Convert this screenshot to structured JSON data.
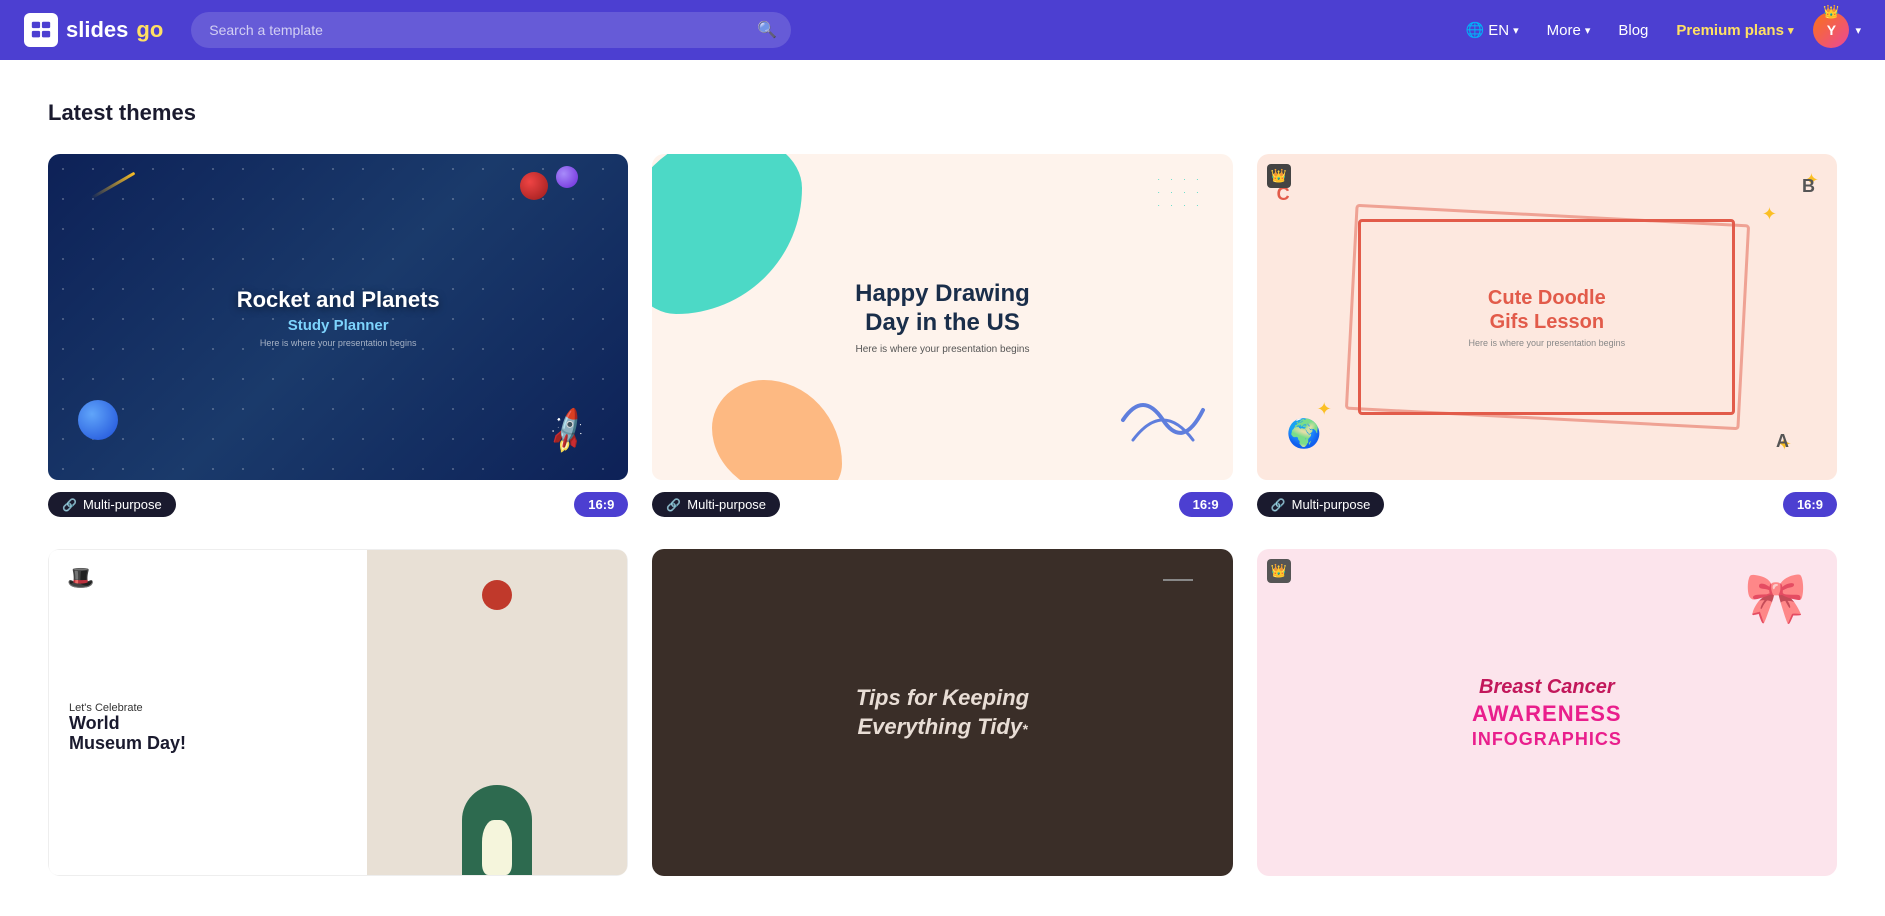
{
  "header": {
    "logo_slides": "slides",
    "logo_go": "go",
    "search_placeholder": "Search a template",
    "lang_label": "EN",
    "more_label": "More",
    "blog_label": "Blog",
    "premium_label": "Premium plans",
    "avatar_initial": "Y"
  },
  "main": {
    "section_title": "Latest themes",
    "themes_row1": [
      {
        "id": "rocket-planets",
        "title": "Rocket and Planets",
        "subtitle": "Study Planner",
        "desc": "Here is where your presentation begins",
        "tag": "Multi-purpose",
        "ratio": "16:9",
        "premium": false
      },
      {
        "id": "happy-drawing",
        "title": "Happy Drawing Day in the US",
        "subtitle": "",
        "desc": "Here is where your presentation begins",
        "tag": "Multi-purpose",
        "ratio": "16:9",
        "premium": false
      },
      {
        "id": "cute-doodle",
        "title": "Cute Doodle Gifs Lesson",
        "subtitle": "",
        "desc": "Here is where your presentation begins",
        "tag": "Multi-purpose",
        "ratio": "16:9",
        "premium": true
      }
    ],
    "themes_row2": [
      {
        "id": "museum-day",
        "title": "Let's Celebrate World Museum Day!",
        "premium": false
      },
      {
        "id": "tips-tidy",
        "title": "Tips for Keeping Everything Tidy*",
        "premium": false
      },
      {
        "id": "breast-cancer",
        "title1": "Breast Cancer",
        "title2": "AWARENESS",
        "title3": "INFOGRAPHICS",
        "premium": true
      }
    ]
  }
}
